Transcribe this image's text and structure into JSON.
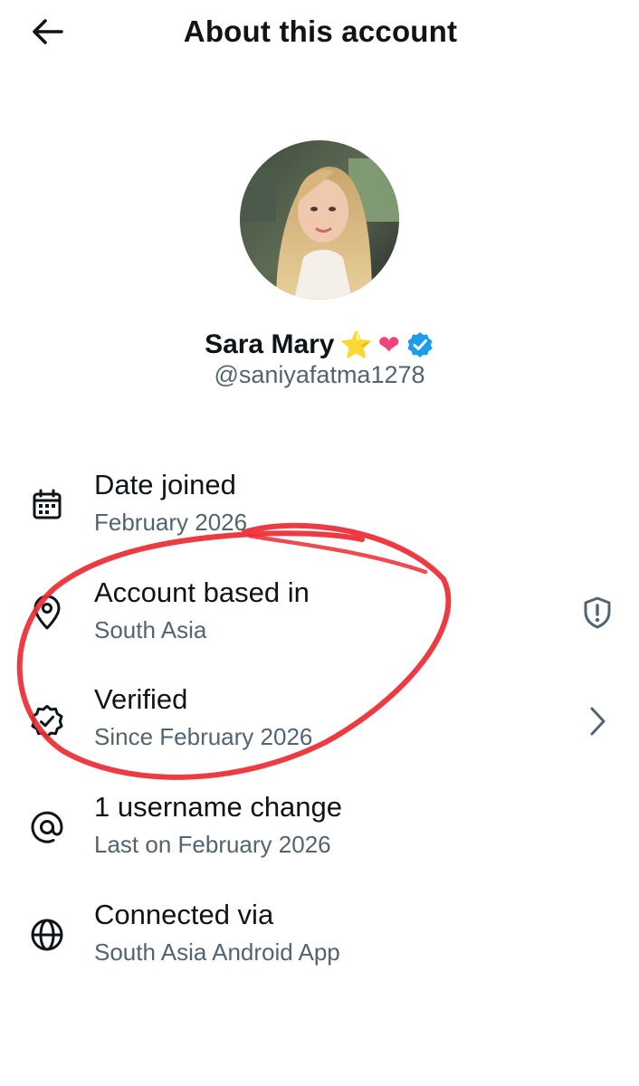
{
  "header": {
    "title": "About this account",
    "back_icon": "arrow-left-icon"
  },
  "profile": {
    "display_name": "Sara Mary",
    "emojis": [
      "⭐",
      "❤"
    ],
    "verified": true,
    "handle": "@saniyafatma1278"
  },
  "rows": [
    {
      "icon": "calendar-icon",
      "label": "Date joined",
      "sub": "February 2026"
    },
    {
      "icon": "location-pin-icon",
      "label": "Account based in",
      "sub": "South Asia",
      "trail_icon": "shield-exclamation-icon"
    },
    {
      "icon": "verified-badge-outline-icon",
      "label": "Verified",
      "sub": "Since February 2026",
      "trail_icon": "chevron-right-icon"
    },
    {
      "icon": "at-sign-icon",
      "label": "1 username change",
      "sub": "Last on February 2026"
    },
    {
      "icon": "globe-icon",
      "label": "Connected via",
      "sub": "South Asia Android App"
    }
  ],
  "colors": {
    "text_primary": "#0f1419",
    "text_secondary": "#536471",
    "verified_blue": "#1d9bf0",
    "annotation_red": "#ec2a33"
  }
}
